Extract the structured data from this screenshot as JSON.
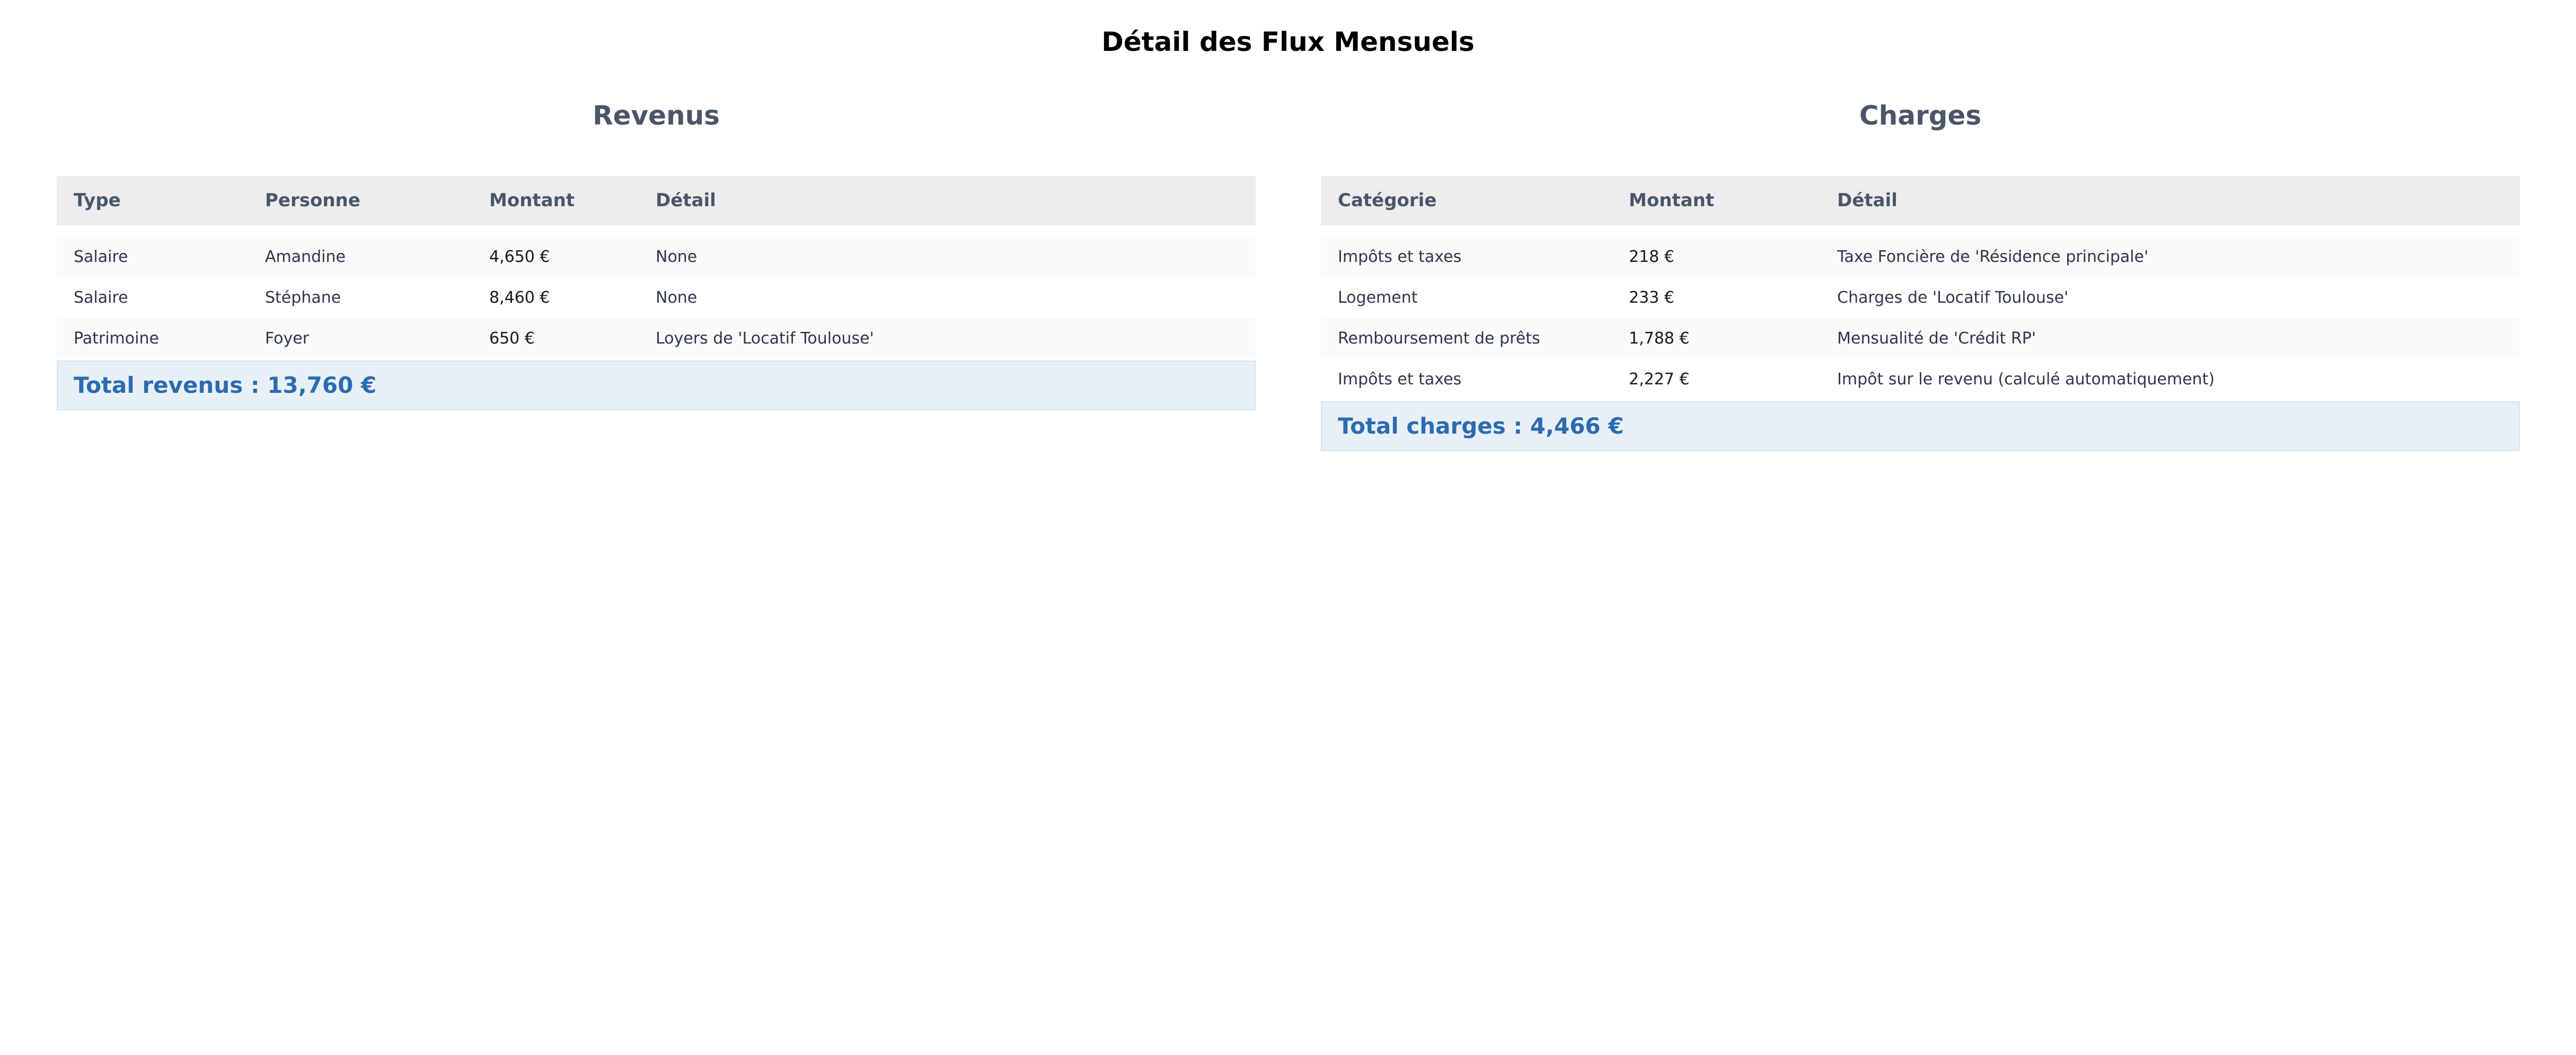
{
  "title": "Détail des Flux Mensuels",
  "revenus": {
    "heading": "Revenus",
    "columns": [
      "Type",
      "Personne",
      "Montant",
      "Détail"
    ],
    "rows": [
      [
        "Salaire",
        "Amandine",
        "4,650 €",
        "None"
      ],
      [
        "Salaire",
        "Stéphane",
        "8,460 €",
        "None"
      ],
      [
        "Patrimoine",
        "Foyer",
        "650 €",
        "Loyers de 'Locatif Toulouse'"
      ]
    ],
    "total": "Total revenus : 13,760 €"
  },
  "charges": {
    "heading": "Charges",
    "columns": [
      "Catégorie",
      "Montant",
      "Détail"
    ],
    "rows": [
      [
        "Impôts et taxes",
        "218 €",
        "Taxe Foncière de 'Résidence principale'"
      ],
      [
        "Logement",
        "233 €",
        "Charges de 'Locatif Toulouse'"
      ],
      [
        "Remboursement de prêts",
        "1,788 €",
        "Mensualité de 'Crédit RP'"
      ],
      [
        "Impôts et taxes",
        "2,227 €",
        "Impôt sur le revenu (calculé automatiquement)"
      ]
    ],
    "total": "Total charges : 4,466 €"
  },
  "colors": {
    "header_bg": "#ebedef",
    "heading_text": "#4a5568",
    "total_bg": "#e8f0f7",
    "total_text": "#2b6cb0"
  }
}
